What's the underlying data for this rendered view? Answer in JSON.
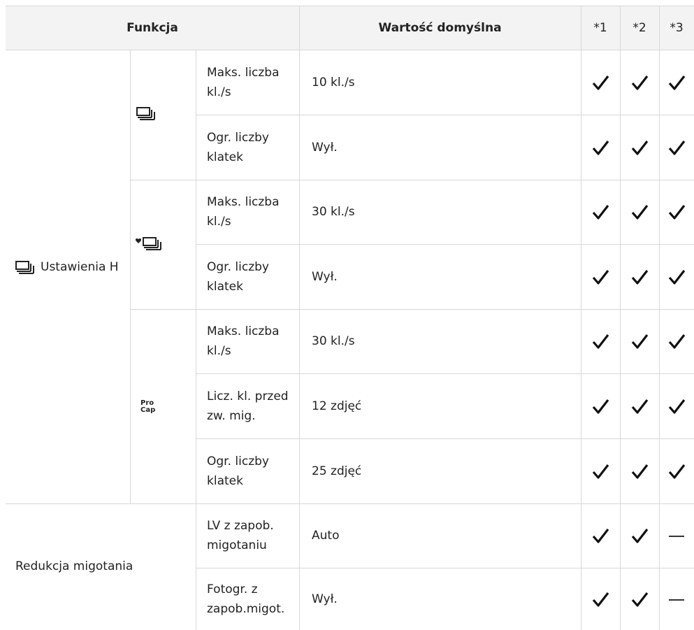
{
  "header": {
    "col_function": "Funkcja",
    "col_default": "Wartość domyślna",
    "col_1": "*1",
    "col_2": "*2",
    "col_3": "*3"
  },
  "groups": {
    "h_settings_label": "Ustawienia H",
    "h_settings_icon": "sequential-shooting-h-icon",
    "silent_icon": "silent-sequential-icon",
    "procap_label": "Pro Cap",
    "flicker_label": "Redukcja migotania"
  },
  "rows": [
    {
      "setting": "Maks. liczba kl./s",
      "value": "10 kl./s",
      "c1": "check",
      "c2": "check",
      "c3": "check"
    },
    {
      "setting": "Ogr. liczby klatek",
      "value": "Wył.",
      "c1": "check",
      "c2": "check",
      "c3": "check"
    },
    {
      "setting": "Maks. liczba kl./s",
      "value": "30 kl./s",
      "c1": "check",
      "c2": "check",
      "c3": "check"
    },
    {
      "setting": "Ogr. liczby klatek",
      "value": "Wył.",
      "c1": "check",
      "c2": "check",
      "c3": "check"
    },
    {
      "setting": "Maks. liczba kl./s",
      "value": "30 kl./s",
      "c1": "check",
      "c2": "check",
      "c3": "check"
    },
    {
      "setting": "Licz. kl. przed zw. mig.",
      "value": "12 zdjęć",
      "c1": "check",
      "c2": "check",
      "c3": "check"
    },
    {
      "setting": "Ogr. liczby klatek",
      "value": "25 zdjęć",
      "c1": "check",
      "c2": "check",
      "c3": "check"
    },
    {
      "setting": "LV z zapob. migotaniu",
      "value": "Auto",
      "c1": "check",
      "c2": "check",
      "c3": "dash"
    },
    {
      "setting": "Fotogr. z zapob.migot.",
      "value": "Wył.",
      "c1": "check",
      "c2": "check",
      "c3": "dash"
    }
  ]
}
